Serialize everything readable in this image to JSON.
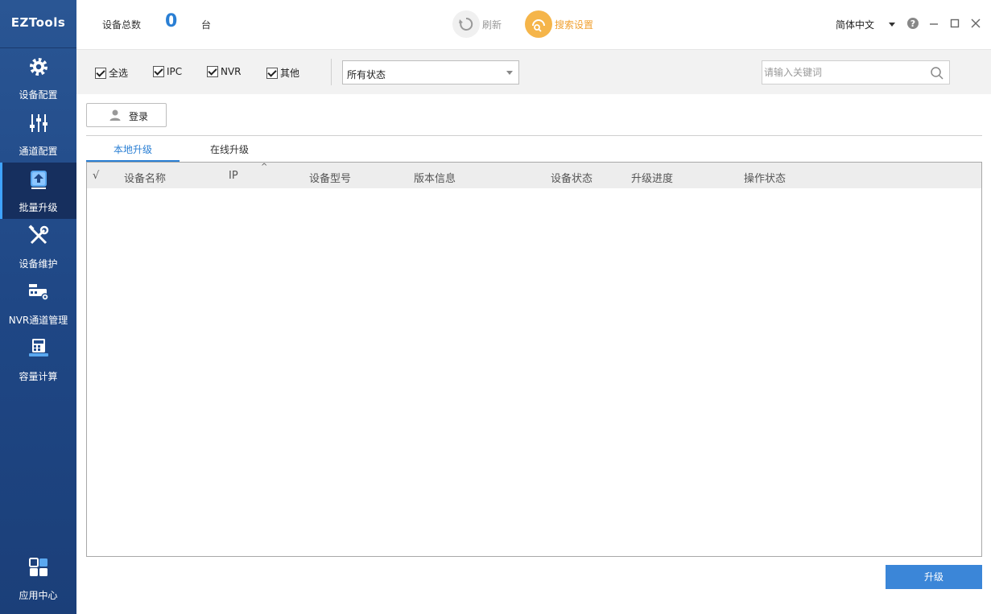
{
  "app": {
    "logo": "EZTools"
  },
  "sidebar": {
    "items": [
      {
        "label": "设备配置",
        "icon": "gear-icon"
      },
      {
        "label": "通道配置",
        "icon": "sliders-icon"
      },
      {
        "label": "批量升级",
        "icon": "upgrade-icon",
        "active": true
      },
      {
        "label": "设备维护",
        "icon": "wrench-icon"
      },
      {
        "label": "NVR通道管理",
        "icon": "nvr-icon"
      },
      {
        "label": "容量计算",
        "icon": "calculator-icon"
      }
    ],
    "app_center": {
      "label": "应用中心",
      "icon": "app-grid-icon"
    }
  },
  "header": {
    "device_total_label": "设备总数",
    "device_count": "0",
    "unit": "台",
    "refresh_label": "刷新",
    "search_settings_label": "搜索设置",
    "language": "简体中文"
  },
  "filters": {
    "select_all": "全选",
    "ipc": "IPC",
    "nvr": "NVR",
    "other": "其他",
    "status_select": "所有状态",
    "search_placeholder": "请输入关键词"
  },
  "actions": {
    "login_label": "登录",
    "upgrade_label": "升级"
  },
  "tabs": [
    {
      "label": "本地升级",
      "active": true
    },
    {
      "label": "在线升级",
      "active": false
    }
  ],
  "table": {
    "columns": [
      "√",
      "设备名称",
      "IP",
      "设备型号",
      "版本信息",
      "设备状态",
      "升级进度",
      "操作状态"
    ],
    "sort_indicator": "^",
    "rows": []
  },
  "colors": {
    "sidebar": "#1f4785",
    "accent": "#2a7fd4",
    "search_settings": "#f0a030",
    "upgrade_button": "#3b86d8"
  }
}
